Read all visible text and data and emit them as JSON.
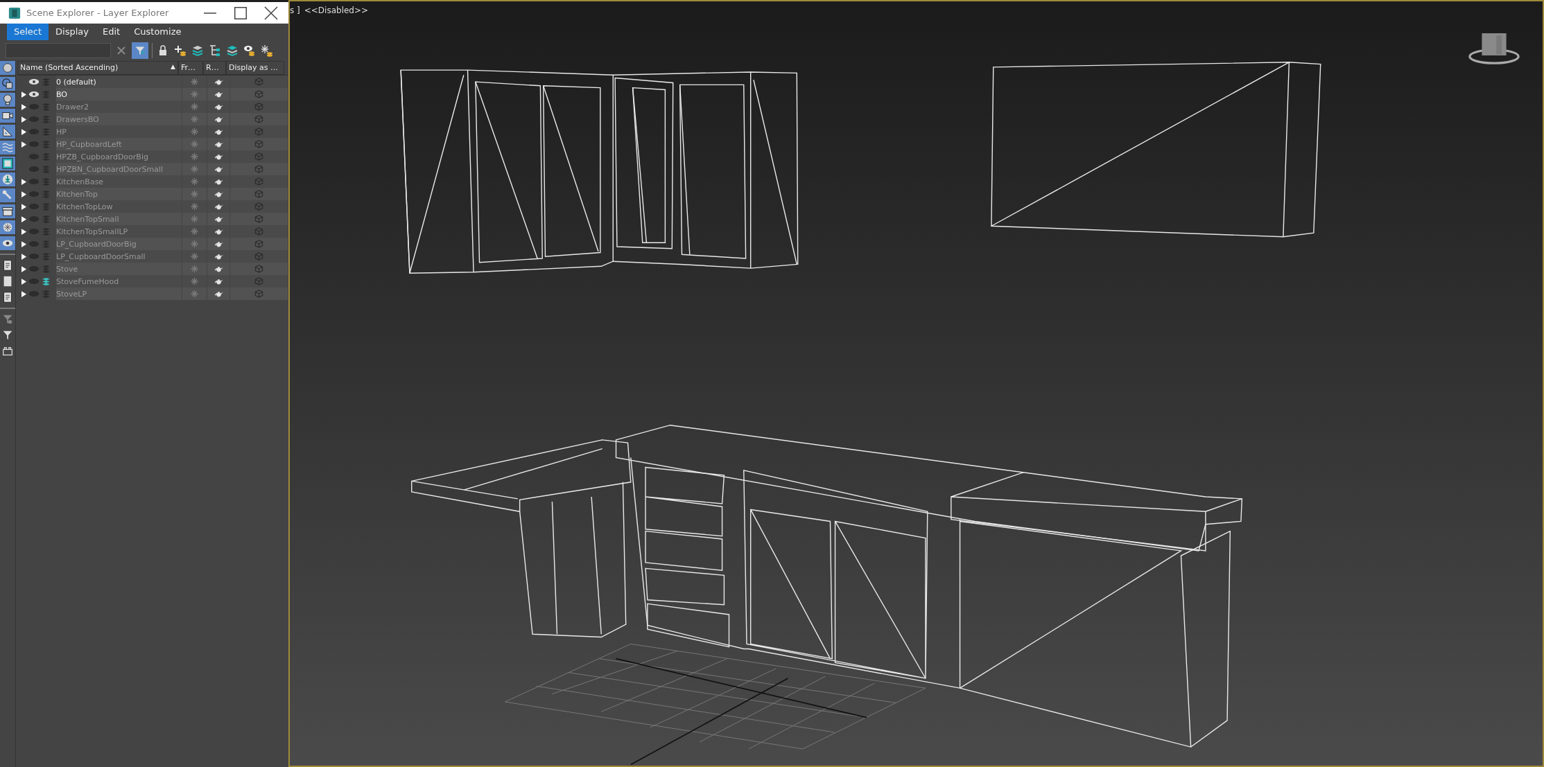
{
  "window": {
    "title": "Scene Explorer - Layer Explorer"
  },
  "menu": [
    {
      "label": "Select",
      "selected": true
    },
    {
      "label": "Display",
      "selected": false
    },
    {
      "label": "Edit",
      "selected": false
    },
    {
      "label": "Customize",
      "selected": false
    }
  ],
  "toolbar": {
    "filter_on": true
  },
  "side_toggles": [
    {
      "kind": "circle",
      "on": true
    },
    {
      "kind": "shapes",
      "on": true
    },
    {
      "kind": "light",
      "on": true
    },
    {
      "kind": "camera",
      "on": true
    },
    {
      "kind": "helper",
      "on": true
    },
    {
      "kind": "wave",
      "on": true
    },
    {
      "kind": "group",
      "on": true
    },
    {
      "kind": "download",
      "on": true
    },
    {
      "kind": "bone",
      "on": true
    },
    {
      "kind": "container",
      "on": true
    },
    {
      "kind": "snow",
      "on": true
    },
    {
      "kind": "eye",
      "on": true
    },
    {
      "kind": "doc",
      "on": false
    },
    {
      "kind": "square",
      "on": false
    },
    {
      "kind": "doc",
      "on": false
    },
    {
      "kind": "filtergear",
      "on": false
    },
    {
      "kind": "filter",
      "on": false
    },
    {
      "kind": "block",
      "on": false
    }
  ],
  "columns": {
    "name": "Name (Sorted Ascending)",
    "sort": "▲",
    "frozen": "Fr…",
    "render": "R…",
    "display": "Display as …"
  },
  "rows": [
    {
      "name": "0 (default)",
      "expandable": false,
      "visible": true,
      "current": false
    },
    {
      "name": "BO",
      "expandable": true,
      "visible": true,
      "current": false
    },
    {
      "name": "Drawer2",
      "expandable": true,
      "visible": false,
      "current": false
    },
    {
      "name": "DrawersBO",
      "expandable": true,
      "visible": false,
      "current": false
    },
    {
      "name": "HP",
      "expandable": true,
      "visible": false,
      "current": false
    },
    {
      "name": "HP_CupboardLeft",
      "expandable": true,
      "visible": false,
      "current": false
    },
    {
      "name": "HPZB_CupboardDoorBig",
      "expandable": false,
      "visible": false,
      "current": false
    },
    {
      "name": "HPZBN_CupboardDoorSmall",
      "expandable": false,
      "visible": false,
      "current": false
    },
    {
      "name": "KitchenBase",
      "expandable": true,
      "visible": false,
      "current": false
    },
    {
      "name": "KitchenTop",
      "expandable": true,
      "visible": false,
      "current": false
    },
    {
      "name": "KitchenTopLow",
      "expandable": true,
      "visible": false,
      "current": false
    },
    {
      "name": "KitchenTopSmall",
      "expandable": true,
      "visible": false,
      "current": false
    },
    {
      "name": "KitchenTopSmallLP",
      "expandable": true,
      "visible": false,
      "current": false
    },
    {
      "name": "LP_CupboardDoorBig",
      "expandable": true,
      "visible": false,
      "current": false
    },
    {
      "name": "LP_CupboardDoorSmall",
      "expandable": true,
      "visible": false,
      "current": false
    },
    {
      "name": "Stove",
      "expandable": true,
      "visible": false,
      "current": false
    },
    {
      "name": "StoveFumeHood",
      "expandable": true,
      "visible": false,
      "current": true
    },
    {
      "name": "StoveLP",
      "expandable": true,
      "visible": false,
      "current": false
    }
  ],
  "viewport": {
    "label_prefix": "s ]",
    "label": "<<Disabled>>"
  }
}
